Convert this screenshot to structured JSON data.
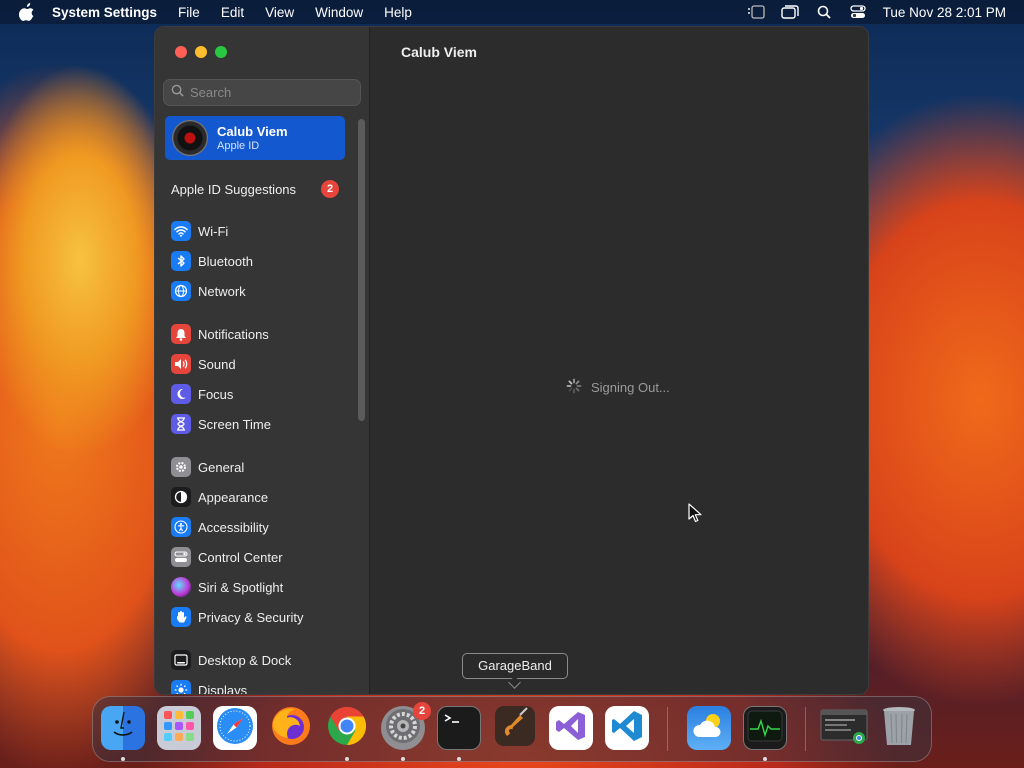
{
  "menubar": {
    "app_name": "System Settings",
    "menus": [
      "File",
      "Edit",
      "View",
      "Window",
      "Help"
    ],
    "clock": "Tue Nov 28  2:01 PM"
  },
  "sidebar": {
    "search_placeholder": "Search",
    "account": {
      "name": "Calub Viem",
      "subtitle": "Apple ID"
    },
    "suggestions": {
      "label": "Apple ID Suggestions",
      "badge": "2"
    },
    "items": [
      {
        "label": "Wi-Fi",
        "icon": "wifi-icon",
        "color": "#1a7cf5"
      },
      {
        "label": "Bluetooth",
        "icon": "bluetooth-icon",
        "color": "#1a7cf5"
      },
      {
        "label": "Network",
        "icon": "globe-icon",
        "color": "#1a7cf5"
      },
      {
        "label": "Notifications",
        "icon": "bell-icon",
        "color": "#e5453b"
      },
      {
        "label": "Sound",
        "icon": "speaker-icon",
        "color": "#e5453b"
      },
      {
        "label": "Focus",
        "icon": "moon-icon",
        "color": "#5e5ce6"
      },
      {
        "label": "Screen Time",
        "icon": "hourglass-icon",
        "color": "#5e5ce6"
      },
      {
        "label": "General",
        "icon": "gear-icon",
        "color": "#8e8e93"
      },
      {
        "label": "Appearance",
        "icon": "appearance-icon",
        "color": "#1c1c1e"
      },
      {
        "label": "Accessibility",
        "icon": "accessibility-icon",
        "color": "#1a7cf5"
      },
      {
        "label": "Control Center",
        "icon": "control-center-icon",
        "color": "#8e8e93"
      },
      {
        "label": "Siri & Spotlight",
        "icon": "siri-icon",
        "color": "#c03ad6"
      },
      {
        "label": "Privacy & Security",
        "icon": "hand-icon",
        "color": "#1a7cf5"
      },
      {
        "label": "Desktop & Dock",
        "icon": "desktop-icon",
        "color": "#1c1c1e"
      },
      {
        "label": "Displays",
        "icon": "sun-icon",
        "color": "#1a7cf5"
      }
    ]
  },
  "main": {
    "title": "Calub Viem",
    "status": "Signing Out..."
  },
  "tooltip": "GarageBand",
  "dock": {
    "apps": [
      {
        "name": "Finder",
        "icon": "finder-icon"
      },
      {
        "name": "Launchpad",
        "icon": "launchpad-icon"
      },
      {
        "name": "Safari",
        "icon": "safari-icon"
      },
      {
        "name": "Firefox",
        "icon": "firefox-icon"
      },
      {
        "name": "Chrome",
        "icon": "chrome-icon"
      },
      {
        "name": "System Settings",
        "icon": "system-settings-icon",
        "badge": "2"
      },
      {
        "name": "Terminal",
        "icon": "terminal-icon"
      },
      {
        "name": "GarageBand",
        "icon": "garageband-icon"
      },
      {
        "name": "Visual Studio",
        "icon": "visual-studio-icon"
      },
      {
        "name": "VS Code",
        "icon": "vscode-icon"
      },
      {
        "name": "Weather",
        "icon": "weather-icon"
      },
      {
        "name": "Activity Monitor",
        "icon": "activity-monitor-icon"
      },
      {
        "name": "Chrome Window",
        "icon": "chrome-window-icon"
      },
      {
        "name": "Trash",
        "icon": "trash-icon"
      }
    ]
  }
}
